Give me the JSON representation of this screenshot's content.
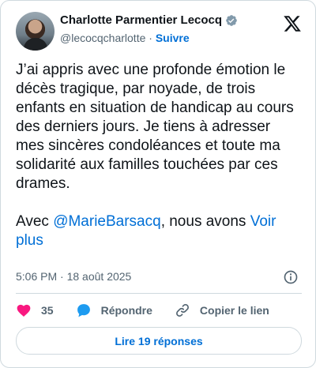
{
  "author": {
    "name": "Charlotte Parmentier Lecocq",
    "handle": "@lecocqcharlotte",
    "separator": "·",
    "follow_label": "Suivre"
  },
  "tweet": {
    "text_main": "J’ai appris avec une profonde émotion le décès tragique, par noyade, de trois enfants en situation de handicap au cours des derniers jours. Je tiens à adresser mes sincères condoléances et toute ma solidarité aux familles touchées par ces drames.",
    "text_prefix": "Avec ",
    "mention": "@MarieBarsacq",
    "text_suffix": ", nous avons ",
    "more_label": "Voir plus"
  },
  "meta": {
    "time": "5:06 PM",
    "separator": "·",
    "date": "18 août 2025"
  },
  "actions": {
    "likes_count": "35",
    "reply_label": "Répondre",
    "copy_link_label": "Copier le lien"
  },
  "replies_button_label": "Lire 19 réponses",
  "colors": {
    "accent": "#006fd6",
    "like": "#f91880",
    "reply_icon": "#1d9bf0",
    "secondary_text": "#536471"
  },
  "icons": [
    "verified-badge-icon",
    "x-logo-icon",
    "info-icon",
    "heart-icon",
    "reply-bubble-icon",
    "link-icon"
  ]
}
